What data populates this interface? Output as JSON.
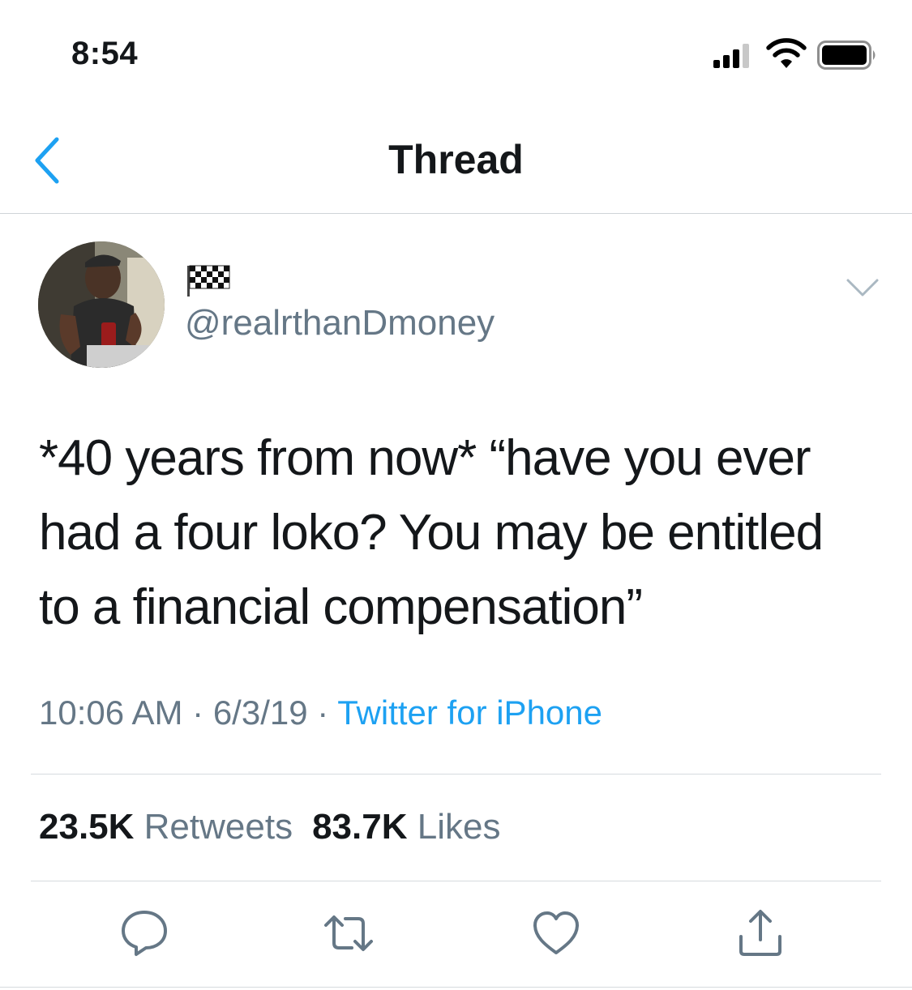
{
  "status_bar": {
    "time": "8:54",
    "icons": [
      "signal-icon",
      "wifi-icon",
      "battery-icon"
    ]
  },
  "nav": {
    "title": "Thread",
    "back_icon": "chevron-left-icon"
  },
  "tweet": {
    "avatar": "user-avatar-photo",
    "display_name_icon": "checkered-flag-icon",
    "handle": "@realrthanDmoney",
    "menu_icon": "chevron-down-icon",
    "text": "*40 years from now* “have you ever had a four loko? You may be entitled to a financial compensation”",
    "time": "10:06 AM",
    "separator": "·",
    "date": "6/3/19",
    "source": "Twitter for iPhone",
    "retweets_count": "23.5K",
    "retweets_label": "Retweets",
    "likes_count": "83.7K",
    "likes_label": "Likes"
  },
  "actions": [
    "reply-icon",
    "retweet-icon",
    "like-icon",
    "share-icon"
  ],
  "colors": {
    "accent": "#1da1f2",
    "secondary_text": "#657786",
    "primary_text": "#14171a"
  }
}
